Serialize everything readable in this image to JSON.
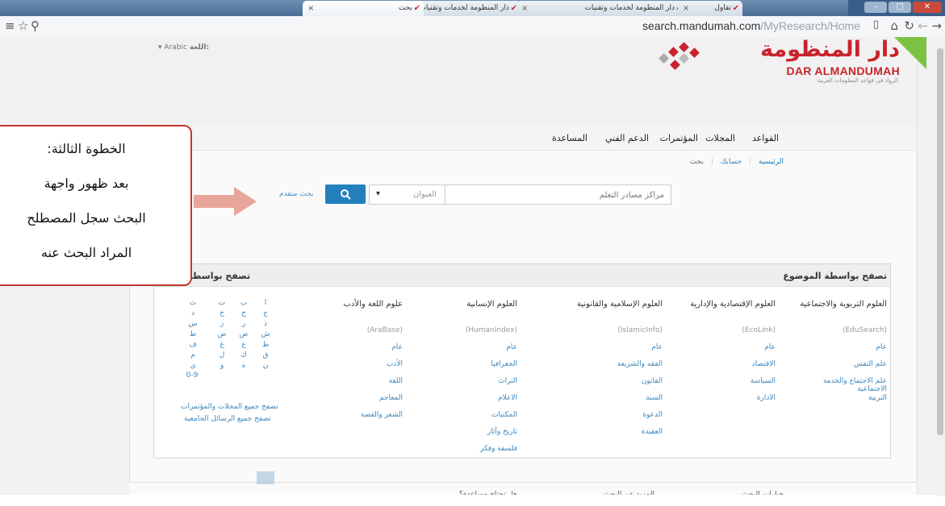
{
  "browser": {
    "tabs": [
      {
        "label": "دار المنظومة لخدمات وتقنيات"
      },
      {
        "label": "تقاول"
      },
      {
        "label": "دار المنظومة لخدمات وتقنيات"
      },
      {
        "label": "بحث"
      }
    ],
    "url_host": "search.mandumah.com",
    "url_path": "/MyResearch/Home"
  },
  "header": {
    "language_label": "اللغة:",
    "language_value": "Arabic",
    "logo_ar": "دار المنظومة",
    "logo_en": "DAR ALMANDUMAH",
    "logo_tagline": "الرواد في قواعد المعلومات العربية"
  },
  "nav": {
    "items": [
      "القواعد",
      "المجلات",
      "المؤتمرات",
      "الدعم الفني",
      "المساعدة"
    ]
  },
  "breadcrumb": {
    "home": "الرئيسية",
    "account": "حسابك",
    "current": "بحث"
  },
  "search": {
    "placeholder": "مراكز مصادر التعلم",
    "field_select": "العنوان",
    "advanced": "بحث متقدم"
  },
  "browse": {
    "by_subject_title": "تصفح بواسطة الموضوع",
    "by_title_title": "تصفح بواسطة العنوان",
    "columns": [
      {
        "title": "العلوم التربوية والاجتماعية",
        "db": "(EduSearch)",
        "links": [
          "عام",
          "علم النفس",
          "علم الاجتماع والخدمة الاجتماعية",
          "التربية"
        ]
      },
      {
        "title": "العلوم الإقتصادية والإدارية",
        "db": "(EcoLink)",
        "links": [
          "عام",
          "الاقتصاد",
          "السياسة",
          "الادارة"
        ]
      },
      {
        "title": "العلوم الإسلامية والقانونية",
        "db": "(IslamicInfo)",
        "links": [
          "عام",
          "الفقه والشريعة",
          "القانون",
          "السنة",
          "الدعوة",
          "العقيدة"
        ]
      },
      {
        "title": "العلوم الإنسانية",
        "db": "(HumanIndex)",
        "links": [
          "عام",
          "الجغرافيا",
          "التراث",
          "الاعلام",
          "المكتبات",
          "تاريخ وآثار",
          "فلسفة وفكر"
        ]
      },
      {
        "title": "علوم اللغة والأدب",
        "db": "(AraBase)",
        "links": [
          "عام",
          "الأدب",
          "اللغة",
          "المعاجم",
          "الشعر والقصة"
        ]
      }
    ],
    "letters": [
      [
        "ا",
        "ب",
        "ت",
        "ث"
      ],
      [
        "ج",
        "ح",
        "خ",
        "د"
      ],
      [
        "ذ",
        "ر",
        "ز",
        "س"
      ],
      [
        "ش",
        "ص",
        "ض",
        "ط"
      ],
      [
        "ظ",
        "ع",
        "غ",
        "ف"
      ],
      [
        "ق",
        "ك",
        "ل",
        "م"
      ],
      [
        "ن",
        "ه",
        "و",
        "ي"
      ]
    ],
    "numbers": "0-9",
    "all_journals": "تصفح جميع المجلات والمؤتمرات",
    "all_theses": "تصفح جميع الرسائل الجامعية"
  },
  "footer": {
    "items": [
      "خيارات البحث",
      "المزيد عن البحث",
      "هل تحتاج مساعدة؟"
    ]
  },
  "callout": {
    "lines": [
      "الخطوة الثالثة:",
      "بعد ظهور واجهة",
      "البحث سجل المصطلح",
      "المراد البحث عنه"
    ]
  },
  "colors": {
    "brand": "#c8232c",
    "link": "#3c86bd",
    "button": "#2380bd",
    "callout_border": "#c0392b",
    "arrow": "#e8a59a"
  }
}
